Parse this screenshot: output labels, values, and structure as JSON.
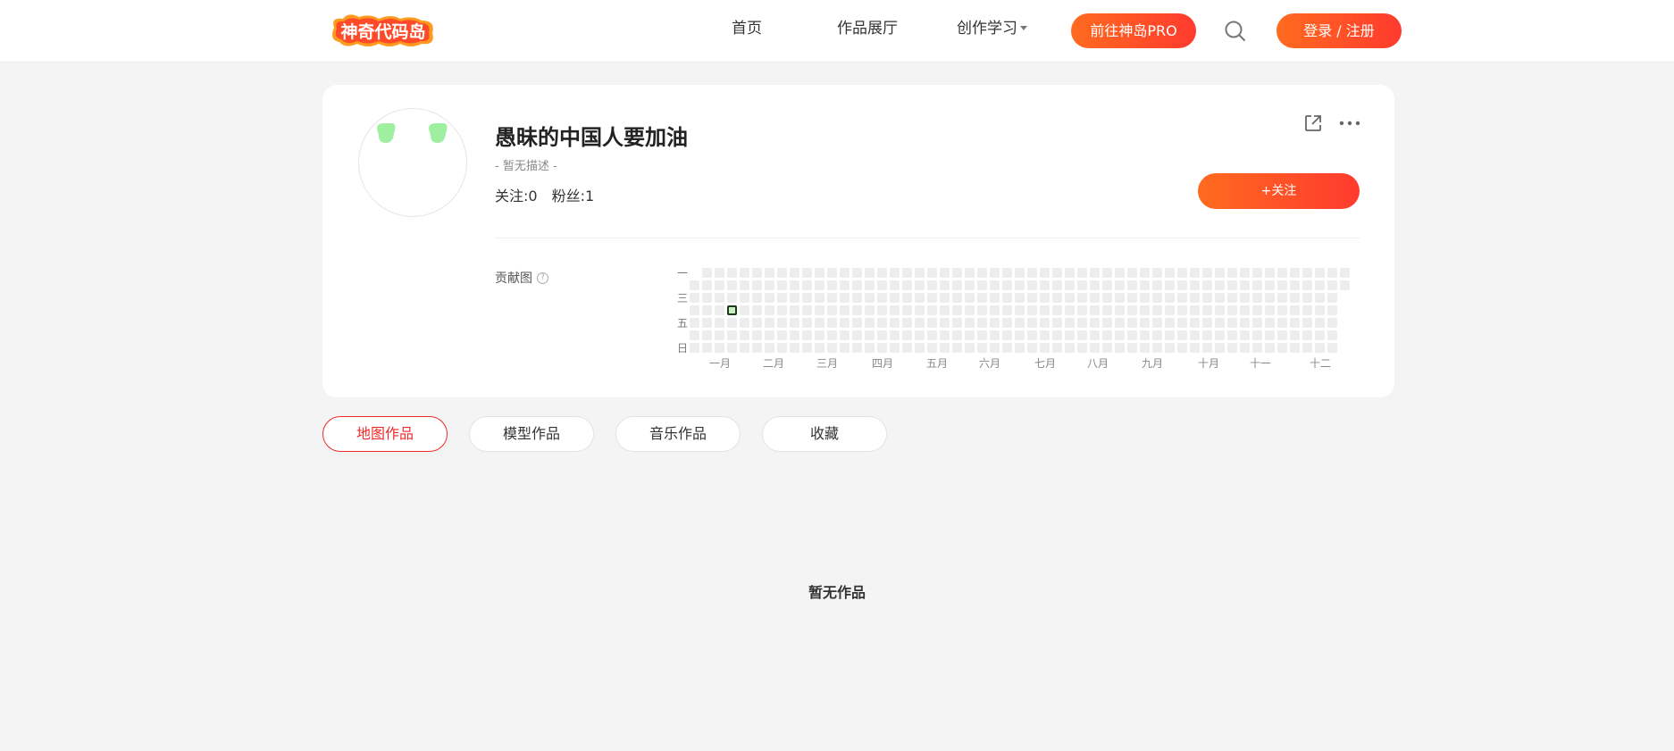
{
  "header": {
    "logo_text": "神奇代码岛",
    "nav": [
      {
        "label": "首页"
      },
      {
        "label": "作品展厅"
      },
      {
        "label": "创作学习"
      }
    ],
    "pro_button": "前往神岛PRO",
    "login_button": "登录 / 注册"
  },
  "profile": {
    "username": "愚昧的中国人要加油",
    "description": "- 暂无描述 -",
    "following": "关注:0",
    "followers": "粉丝:1",
    "follow_button": "+关注"
  },
  "contribution": {
    "label": "贡献图",
    "help_icon": "question-circle-icon",
    "day_labels": [
      "一",
      "三",
      "五",
      "日"
    ],
    "month_labels": [
      "一月",
      "二月",
      "三月",
      "四月",
      "五月",
      "六月",
      "七月",
      "八月",
      "九月",
      "十月",
      "十一",
      "十二"
    ],
    "active_days": [
      {
        "week": 3,
        "day": 3,
        "count": 1
      }
    ]
  },
  "tabs": [
    {
      "label": "地图作品",
      "active": true
    },
    {
      "label": "模型作品",
      "active": false
    },
    {
      "label": "音乐作品",
      "active": false
    },
    {
      "label": "收藏",
      "active": false
    }
  ],
  "empty_message": "暂无作品",
  "colors": {
    "accent_start": "#ff6b1f",
    "accent_end": "#ff3a2e",
    "tab_active": "#ee2a28",
    "heatmap_empty": "#ededed",
    "heatmap_active": "#c6efc0"
  }
}
